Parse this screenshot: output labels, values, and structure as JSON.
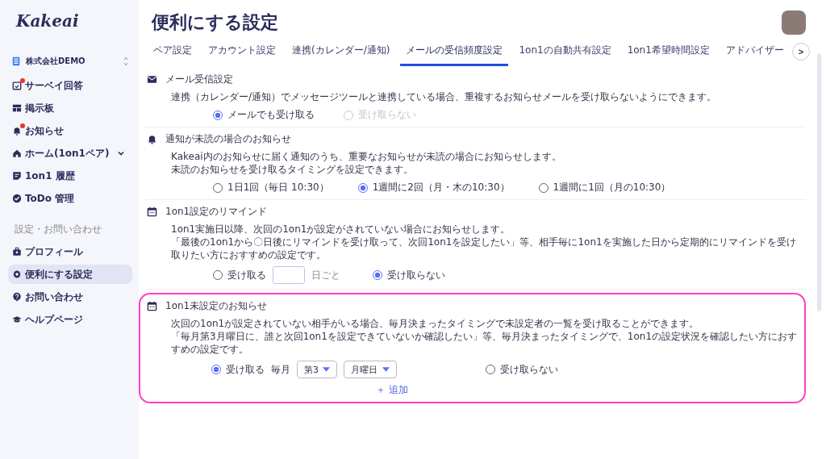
{
  "sidebar": {
    "logo": "Kakeai",
    "organization": "株式会社DEMO",
    "items": [
      {
        "label": "サーベイ回答",
        "badge": true,
        "has_submenu": false,
        "selected": false
      },
      {
        "label": "掲示板",
        "badge": false,
        "has_submenu": false,
        "selected": false
      },
      {
        "label": "お知らせ",
        "badge": true,
        "has_submenu": false,
        "selected": false
      },
      {
        "label": "ホーム(1on1ペア)",
        "badge": false,
        "has_submenu": true,
        "selected": false
      },
      {
        "label": "1on1 履歴",
        "badge": false,
        "has_submenu": false,
        "selected": false
      },
      {
        "label": "ToDo 管理",
        "badge": false,
        "has_submenu": false,
        "selected": false
      }
    ],
    "section_label": "設定・お問い合わせ",
    "settings_items": [
      {
        "label": "プロフィール",
        "selected": false
      },
      {
        "label": "便利にする設定",
        "selected": true
      },
      {
        "label": "お問い合わせ",
        "selected": false
      },
      {
        "label": "ヘルプページ",
        "selected": false
      }
    ]
  },
  "page_title": "便利にする設定",
  "tabs": [
    {
      "label": "ペア設定",
      "selected": false
    },
    {
      "label": "アカウント設定",
      "selected": false
    },
    {
      "label": "連携(カレンダー/通知)",
      "selected": false
    },
    {
      "label": "メールの受信頻度設定",
      "selected": true
    },
    {
      "label": "1on1の自動共有設定",
      "selected": false
    },
    {
      "label": "1on1希望時間設定",
      "selected": false
    },
    {
      "label": "アドバイザー",
      "selected": false
    }
  ],
  "tabs_next": ">",
  "sections": [
    {
      "title": "メール受信設定",
      "highlighted": false,
      "description": [
        "連携（カレンダー/通知）でメッセージツールと連携している場合、重複するお知らせメールを受け取らないようにできます。"
      ],
      "options": [
        {
          "kind": "radio",
          "label": "メールでも受け取る",
          "selected": true,
          "disabled": false
        },
        {
          "kind": "radio",
          "label": "受け取らない",
          "selected": false,
          "disabled": true
        }
      ]
    },
    {
      "title": "通知が未読の場合のお知らせ",
      "highlighted": false,
      "description": [
        "Kakeai内のお知らせに届く通知のうち、重要なお知らせが未読の場合にお知らせします。",
        "未読のお知らせを受け取るタイミングを設定できます。"
      ],
      "options": [
        {
          "kind": "radio",
          "label": "1日1回（毎日 10:30）",
          "selected": false,
          "disabled": false
        },
        {
          "kind": "radio",
          "label": "1週間に2回（月・木の10:30）",
          "selected": true,
          "disabled": false
        },
        {
          "kind": "radio",
          "label": "1週間に1回（月の10:30）",
          "selected": false,
          "disabled": false
        }
      ]
    },
    {
      "title": "1on1設定のリマインド",
      "highlighted": false,
      "description": [
        "1on1実施日以降、次回の1on1が設定がされていない場合にお知らせします。",
        "「最後の1on1から〇日後にリマインドを受け取って、次回1on1を設定したい」等、相手毎に1on1を実施した日から定期的にリマインドを受け取りたい方におすすめの設定です。"
      ],
      "options": [
        {
          "kind": "field",
          "label": "受け取る",
          "selected": false,
          "disabled": false,
          "suffix": "日ごと"
        },
        {
          "kind": "radio",
          "label": "受け取らない",
          "selected": true,
          "disabled": false
        }
      ]
    },
    {
      "title": "1on1未設定のお知らせ",
      "highlighted": true,
      "description": [
        "次回の1on1が設定されていない相手がいる場合、毎月決まったタイミングで未設定者の一覧を受け取ることができます。",
        "「毎月第3月曜日に、誰と次回1on1を設定できていないか確認したい」等、毎月決まったタイミングで、1on1の設定状況を確認したい方におすすめの設定です。"
      ],
      "options": [
        {
          "kind": "selects",
          "label": "受け取る",
          "selected": true,
          "disabled": false,
          "prefix": "毎月",
          "selects": [
            "第3",
            "月曜日"
          ]
        },
        {
          "kind": "radio",
          "label": "受け取らない",
          "selected": false,
          "disabled": false
        }
      ],
      "add_button": "＋ 追加"
    }
  ]
}
